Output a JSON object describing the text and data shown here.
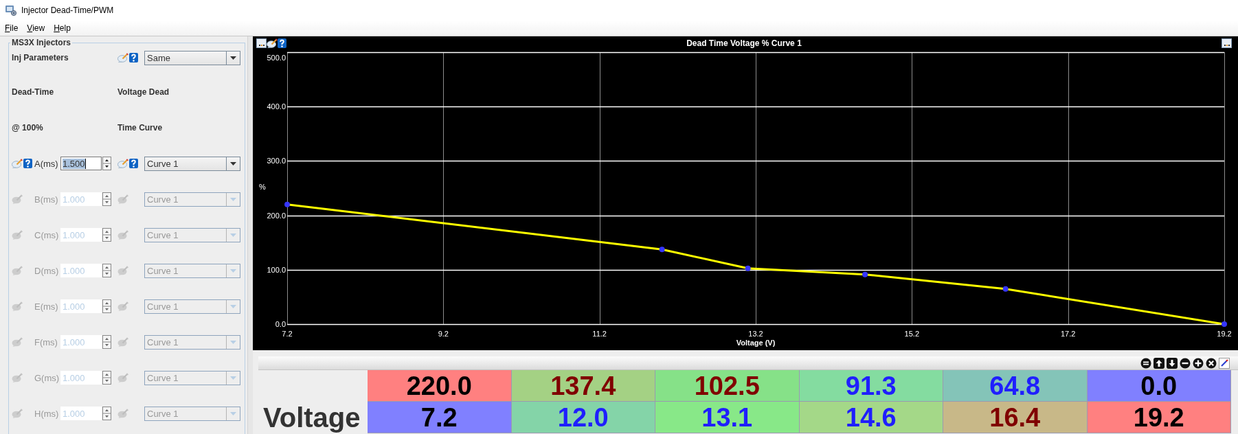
{
  "window": {
    "title": "Injector Dead-Time/PWM"
  },
  "menu": [
    {
      "label": "File"
    },
    {
      "label": "View"
    },
    {
      "label": "Help"
    }
  ],
  "panel": {
    "title": "MS3X Injectors",
    "inj_parameters": {
      "label": "Inj Parameters",
      "value": "Same"
    },
    "dead_time_heading": [
      "Dead-Time",
      "@ 100%"
    ],
    "curve_heading": [
      "Voltage Dead",
      "Time Curve"
    ],
    "injectors": [
      {
        "label": "A(ms)",
        "value": "1.500",
        "curve": "Curve 1",
        "disabled": false,
        "focused": true
      },
      {
        "label": "B(ms)",
        "value": "1.000",
        "curve": "Curve 1",
        "disabled": true,
        "focused": false
      },
      {
        "label": "C(ms)",
        "value": "1.000",
        "curve": "Curve 1",
        "disabled": true,
        "focused": false
      },
      {
        "label": "D(ms)",
        "value": "1.000",
        "curve": "Curve 1",
        "disabled": true,
        "focused": false
      },
      {
        "label": "E(ms)",
        "value": "1.000",
        "curve": "Curve 1",
        "disabled": true,
        "focused": false
      },
      {
        "label": "F(ms)",
        "value": "1.000",
        "curve": "Curve 1",
        "disabled": true,
        "focused": false
      },
      {
        "label": "G(ms)",
        "value": "1.000",
        "curve": "Curve 1",
        "disabled": true,
        "focused": false
      },
      {
        "label": "H(ms)",
        "value": "1.000",
        "curve": "Curve 1",
        "disabled": true,
        "focused": false
      }
    ]
  },
  "chart": {
    "chart_data": {
      "type": "line",
      "title": "Dead Time Voltage % Curve 1",
      "xlabel": "Voltage (V)",
      "ylabel": "%",
      "grid": true,
      "x": [
        7.2,
        12.0,
        13.1,
        14.6,
        16.4,
        19.2
      ],
      "series": [
        {
          "color": "#ffff00",
          "marker": "circle",
          "values": [
            220.0,
            137.4,
            102.5,
            91.3,
            64.8,
            0.0
          ]
        }
      ],
      "xlim": [
        7.2,
        19.2
      ],
      "ylim": [
        0,
        500
      ],
      "xticks": [
        {
          "value": 7.2,
          "label": "7.2"
        },
        {
          "value": 9.2,
          "label": "9.2"
        },
        {
          "value": 11.2,
          "label": "11.2"
        },
        {
          "value": 13.2,
          "label": "13.2"
        },
        {
          "value": 15.2,
          "label": "15.2"
        },
        {
          "value": 17.2,
          "label": "17.2"
        },
        {
          "value": 19.2,
          "label": "19.2"
        }
      ],
      "yticks": [
        {
          "value": 0,
          "label": "0.0"
        },
        {
          "value": 100,
          "label": "100.0"
        },
        {
          "value": 200,
          "label": "200.0"
        },
        {
          "value": 300,
          "label": "300.0"
        },
        {
          "value": 400,
          "label": "400.0"
        },
        {
          "value": 500,
          "label": "500.0"
        }
      ]
    }
  },
  "table": {
    "rows": [
      {
        "cells": [
          {
            "color": "#ff8080",
            "value": {
              "text": "220.0",
              "color": "#000000"
            }
          },
          {
            "color": "#a4d184",
            "value": {
              "text": "137.4",
              "color": "#800000"
            }
          },
          {
            "color": "#86e188",
            "value": {
              "text": "102.5",
              "color": "#800000"
            }
          },
          {
            "color": "#84dca0",
            "value": {
              "text": "91.3",
              "color": "#1f1fff"
            }
          },
          {
            "color": "#84c4b8",
            "value": {
              "text": "64.8",
              "color": "#1f1fff"
            }
          },
          {
            "color": "#8080ff",
            "value": {
              "text": "0.0",
              "color": "#000000"
            }
          }
        ]
      },
      {
        "label": "Voltage",
        "cells": [
          {
            "color": "#8080ff",
            "value": {
              "text": "7.2",
              "color": "#000000"
            }
          },
          {
            "color": "#84d4a8",
            "value": {
              "text": "12.0",
              "color": "#1f1fff"
            }
          },
          {
            "color": "#88e888",
            "value": {
              "text": "13.1",
              "color": "#1f1fff"
            }
          },
          {
            "color": "#a4d888",
            "value": {
              "text": "14.6",
              "color": "#1f1fff"
            }
          },
          {
            "color": "#c8b888",
            "value": {
              "text": "16.4",
              "color": "#800000"
            }
          },
          {
            "color": "#ff8080",
            "value": {
              "text": "19.2",
              "color": "#000000"
            }
          }
        ]
      }
    ]
  }
}
